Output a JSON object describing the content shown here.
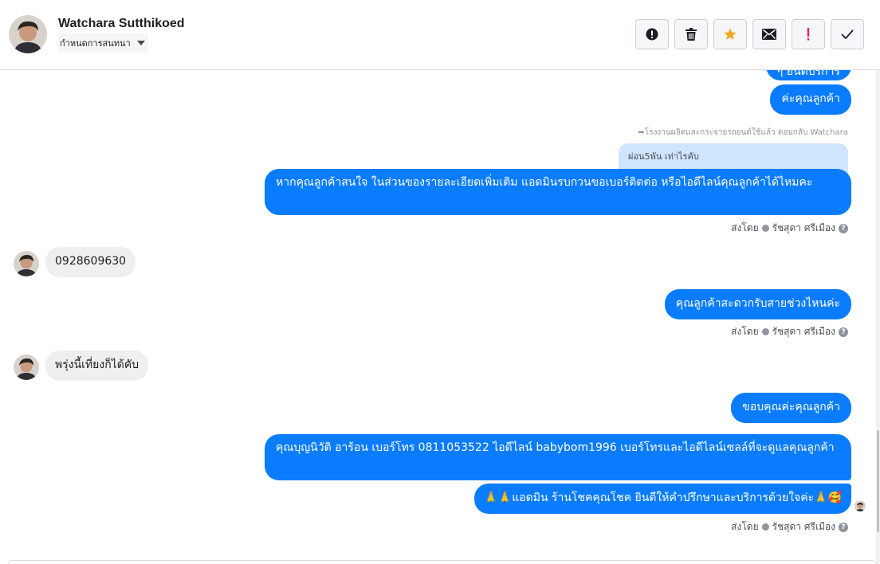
{
  "header": {
    "contact_name": "Watchara Sutthikoed",
    "assign_label": "กำหนดการสนทนา",
    "actions": [
      {
        "icon": "alert-circle-icon",
        "label": "spam"
      },
      {
        "icon": "trash-icon",
        "label": "delete"
      },
      {
        "icon": "star-icon",
        "label": "star"
      },
      {
        "icon": "envelope-icon",
        "label": "mark unread"
      },
      {
        "icon": "exclamation-icon",
        "label": "follow up"
      },
      {
        "icon": "check-icon",
        "label": "done"
      }
    ],
    "colors": {
      "star": "#f5a623",
      "exclamation": "#e0245e"
    }
  },
  "thread": {
    "partial_top": "ๆ ยินดีบริการ",
    "msg1": "ค่ะคุณลูกค้า",
    "reply_meta": "โรงงานผลิตและกระจายรถยนต์ใช้แล้ว ตอบกลับ Watchara",
    "quoted": "ผ่อน5พัน เท่าไรคับ",
    "msg2": "หากคุณลูกค้าสนใจ ในส่วนของรายละเอียดเพิ่มเติม แอดมินรบกวนขอเบอร์ติดต่อ หรือไอดีไลน์คุณลูกค้าได้ไหมคะ",
    "sent_by_label": "ส่งโดย",
    "agent_name": "รัชสุดา ศรีเมือง",
    "in1": "0928609630",
    "msg3": "คุณลูกค้าสะดวกรับสายช่วงไหนค่ะ",
    "in2": "พรุ่งนี้เที่ยงก็ได้คับ",
    "msg4": "ขอบคุณค่ะคุณลูกค้า",
    "msg5": "คุณบุญนิวัติ  อาร้อน        เบอร์โทร 0811053522  ไอดีไลน์ babybom1996   เบอร์โทรและไอดีไลน์เซลล์ที่จะดูแลคุณลูกค้า",
    "msg6": "🙏🙏แอดมิน ร้านโชคคุณโชค ยินดีให้คำปรึกษาและบริการด้วยใจค่ะ🙏🥰",
    "help_glyph": "?",
    "accent": "#0a7cff"
  }
}
